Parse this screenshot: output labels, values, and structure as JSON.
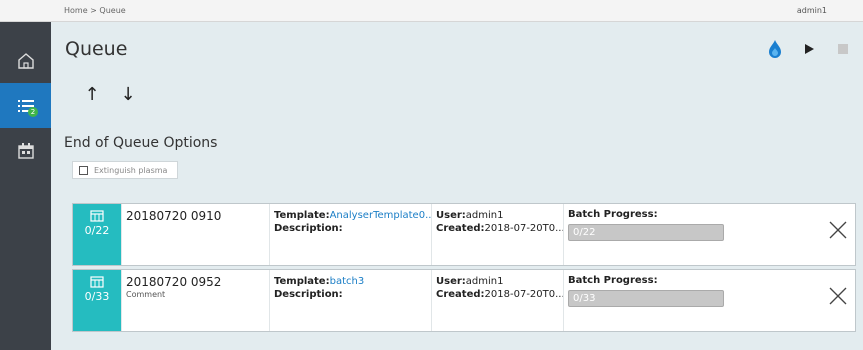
{
  "breadcrumb": "Home > Queue",
  "user": "admin1",
  "page": {
    "title": "Queue"
  },
  "sidebar": {
    "items": [
      {
        "icon": "home-icon",
        "active": false
      },
      {
        "icon": "queue-list-icon",
        "active": true,
        "badge": "2"
      },
      {
        "icon": "calendar-icon",
        "active": false
      }
    ]
  },
  "toolbar": {
    "up_arrow": "↑",
    "down_arrow": "↓"
  },
  "end_options": {
    "title": "End of Queue Options",
    "extinguish_label": "Extinguish plasma",
    "extinguish_checked": false
  },
  "batches": [
    {
      "count": "0/22",
      "name": "20180720 0910",
      "comment": "",
      "template_label": "Template:",
      "template": "AnalyserTemplate0...",
      "description_label": "Description:",
      "user_label": "User:",
      "user": "admin1",
      "created_label": "Created:",
      "created": "2018-07-20T0...",
      "progress_label": "Batch Progress:",
      "progress": "0/22",
      "progress_fraction": 0
    },
    {
      "count": "0/33",
      "name": "20180720 0952",
      "comment": "Comment",
      "template_label": "Template:",
      "template": "batch3",
      "description_label": "Description:",
      "user_label": "User:",
      "user": "admin1",
      "created_label": "Created:",
      "created": "2018-07-20T0...",
      "progress_label": "Batch Progress:",
      "progress": "0/33",
      "progress_fraction": 0
    }
  ],
  "colors": {
    "accent": "#25bcc0",
    "sidebar": "#3c4148",
    "active_nav": "#1f78bf",
    "link": "#1b7ec6",
    "badge": "#3eb549"
  }
}
